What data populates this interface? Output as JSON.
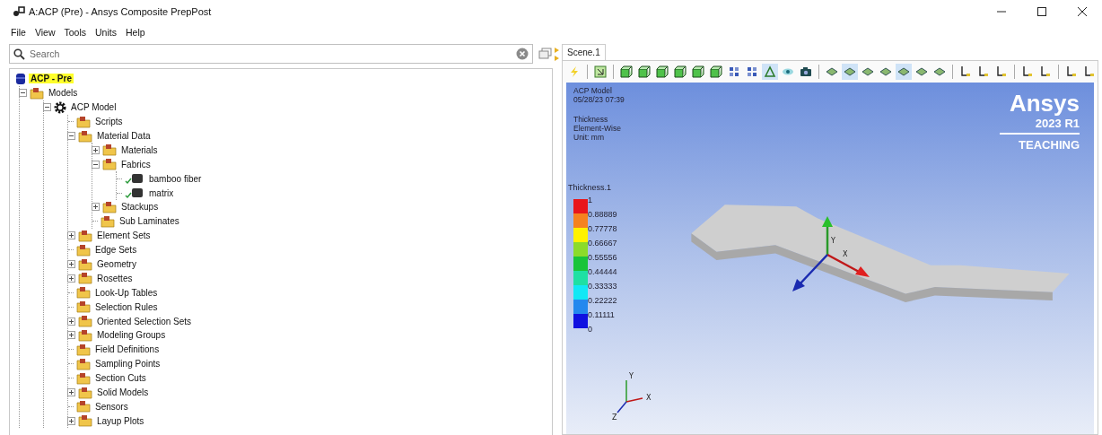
{
  "window": {
    "title": "A:ACP (Pre) - Ansys Composite PrepPost"
  },
  "menu": [
    "File",
    "View",
    "Tools",
    "Units",
    "Help"
  ],
  "search": {
    "placeholder": "Search"
  },
  "tree": [
    {
      "label": "ACP - Pre",
      "kind": "root",
      "selected": true,
      "children": [
        {
          "label": "Models",
          "kind": "folder",
          "expanded": true,
          "selected": false,
          "children": [
            {
              "label": "ACP Model",
              "kind": "model",
              "expanded": true,
              "selected": false,
              "children": [
                {
                  "label": "Scripts",
                  "kind": "folder",
                  "selected": false
                },
                {
                  "label": "Material Data",
                  "kind": "folder",
                  "expanded": true,
                  "selected": false,
                  "children": [
                    {
                      "label": "Materials",
                      "kind": "folder",
                      "expanded": false,
                      "selected": false
                    },
                    {
                      "label": "Fabrics",
                      "kind": "folder",
                      "expanded": true,
                      "selected": false,
                      "children": [
                        {
                          "label": "bamboo fiber",
                          "kind": "fabric",
                          "selected": false
                        },
                        {
                          "label": "matrix",
                          "kind": "fabric",
                          "selected": false
                        }
                      ]
                    },
                    {
                      "label": "Stackups",
                      "kind": "folder",
                      "expanded": false,
                      "selected": false
                    },
                    {
                      "label": "Sub Laminates",
                      "kind": "folder",
                      "selected": false
                    }
                  ]
                },
                {
                  "label": "Element Sets",
                  "kind": "folder",
                  "expanded": false,
                  "selected": false
                },
                {
                  "label": "Edge Sets",
                  "kind": "folder",
                  "selected": false
                },
                {
                  "label": "Geometry",
                  "kind": "folder",
                  "expanded": false,
                  "selected": false
                },
                {
                  "label": "Rosettes",
                  "kind": "folder",
                  "expanded": false,
                  "selected": false
                },
                {
                  "label": "Look-Up Tables",
                  "kind": "folder",
                  "selected": false
                },
                {
                  "label": "Selection Rules",
                  "kind": "folder",
                  "selected": false
                },
                {
                  "label": "Oriented Selection Sets",
                  "kind": "folder",
                  "expanded": false,
                  "selected": false
                },
                {
                  "label": "Modeling Groups",
                  "kind": "folder",
                  "expanded": false,
                  "selected": false
                },
                {
                  "label": "Field Definitions",
                  "kind": "folder",
                  "selected": false
                },
                {
                  "label": "Sampling Points",
                  "kind": "folder",
                  "selected": false
                },
                {
                  "label": "Section Cuts",
                  "kind": "folder",
                  "selected": false
                },
                {
                  "label": "Solid Models",
                  "kind": "folder",
                  "expanded": false,
                  "selected": false
                },
                {
                  "label": "Sensors",
                  "kind": "folder",
                  "selected": false
                },
                {
                  "label": "Layup Plots",
                  "kind": "folder",
                  "expanded": false,
                  "selected": false
                }
              ]
            }
          ]
        }
      ]
    }
  ],
  "tabs": [
    {
      "label": "Scene.1",
      "selected": true
    }
  ],
  "toolbar": [
    [
      {
        "kind": "bolt",
        "selected": false
      }
    ],
    [
      {
        "kind": "fit",
        "selected": false
      }
    ],
    [
      {
        "kind": "cube",
        "selected": false
      },
      {
        "kind": "cube",
        "selected": false
      },
      {
        "kind": "cube",
        "selected": false
      },
      {
        "kind": "cube",
        "selected": false
      },
      {
        "kind": "cube",
        "selected": false
      },
      {
        "kind": "cube",
        "selected": false
      },
      {
        "kind": "pick",
        "selected": false
      },
      {
        "kind": "pick",
        "selected": false
      },
      {
        "kind": "tool",
        "selected": true
      },
      {
        "kind": "eye",
        "selected": false
      },
      {
        "kind": "camera",
        "selected": false
      }
    ],
    [
      {
        "kind": "layer",
        "selected": false
      },
      {
        "kind": "layer",
        "selected": true
      },
      {
        "kind": "layer",
        "selected": false
      },
      {
        "kind": "layer",
        "selected": false
      },
      {
        "kind": "layer",
        "selected": true
      },
      {
        "kind": "layer",
        "selected": false
      },
      {
        "kind": "layer",
        "selected": false
      }
    ],
    [
      {
        "kind": "axes",
        "selected": false
      },
      {
        "kind": "axes",
        "selected": false
      },
      {
        "kind": "axes",
        "selected": false
      }
    ],
    [
      {
        "kind": "axes",
        "selected": false
      },
      {
        "kind": "axes",
        "selected": false
      }
    ],
    [
      {
        "kind": "axes",
        "selected": false
      },
      {
        "kind": "axes",
        "selected": false
      }
    ]
  ],
  "scene": {
    "model": "ACP Model",
    "timestamp": "05/28/23 07:39",
    "quantity": "Thickness",
    "mode": "Element-Wise",
    "unit": "Unit: mm",
    "logo": {
      "name": "Ansys",
      "version": "2023 R1",
      "edition": "TEACHING"
    },
    "legend": {
      "title": "Thickness.1",
      "labels": [
        "1",
        "0.88889",
        "0.77778",
        "0.66667",
        "0.55556",
        "0.44444",
        "0.33333",
        "0.22222",
        "0.11111",
        "0"
      ],
      "bands": [
        {
          "color": "#e8161b"
        },
        {
          "color": "#f5821f"
        },
        {
          "color": "#fff200"
        },
        {
          "color": "#8cdb2a"
        },
        {
          "color": "#19c43a"
        },
        {
          "color": "#1fe0a3"
        },
        {
          "color": "#12e8f5"
        },
        {
          "color": "#2488ee"
        },
        {
          "color": "#1010e0"
        }
      ]
    },
    "model_triad": [
      "Y",
      "X"
    ],
    "corner_triad": [
      "Y",
      "X",
      "Z"
    ]
  }
}
